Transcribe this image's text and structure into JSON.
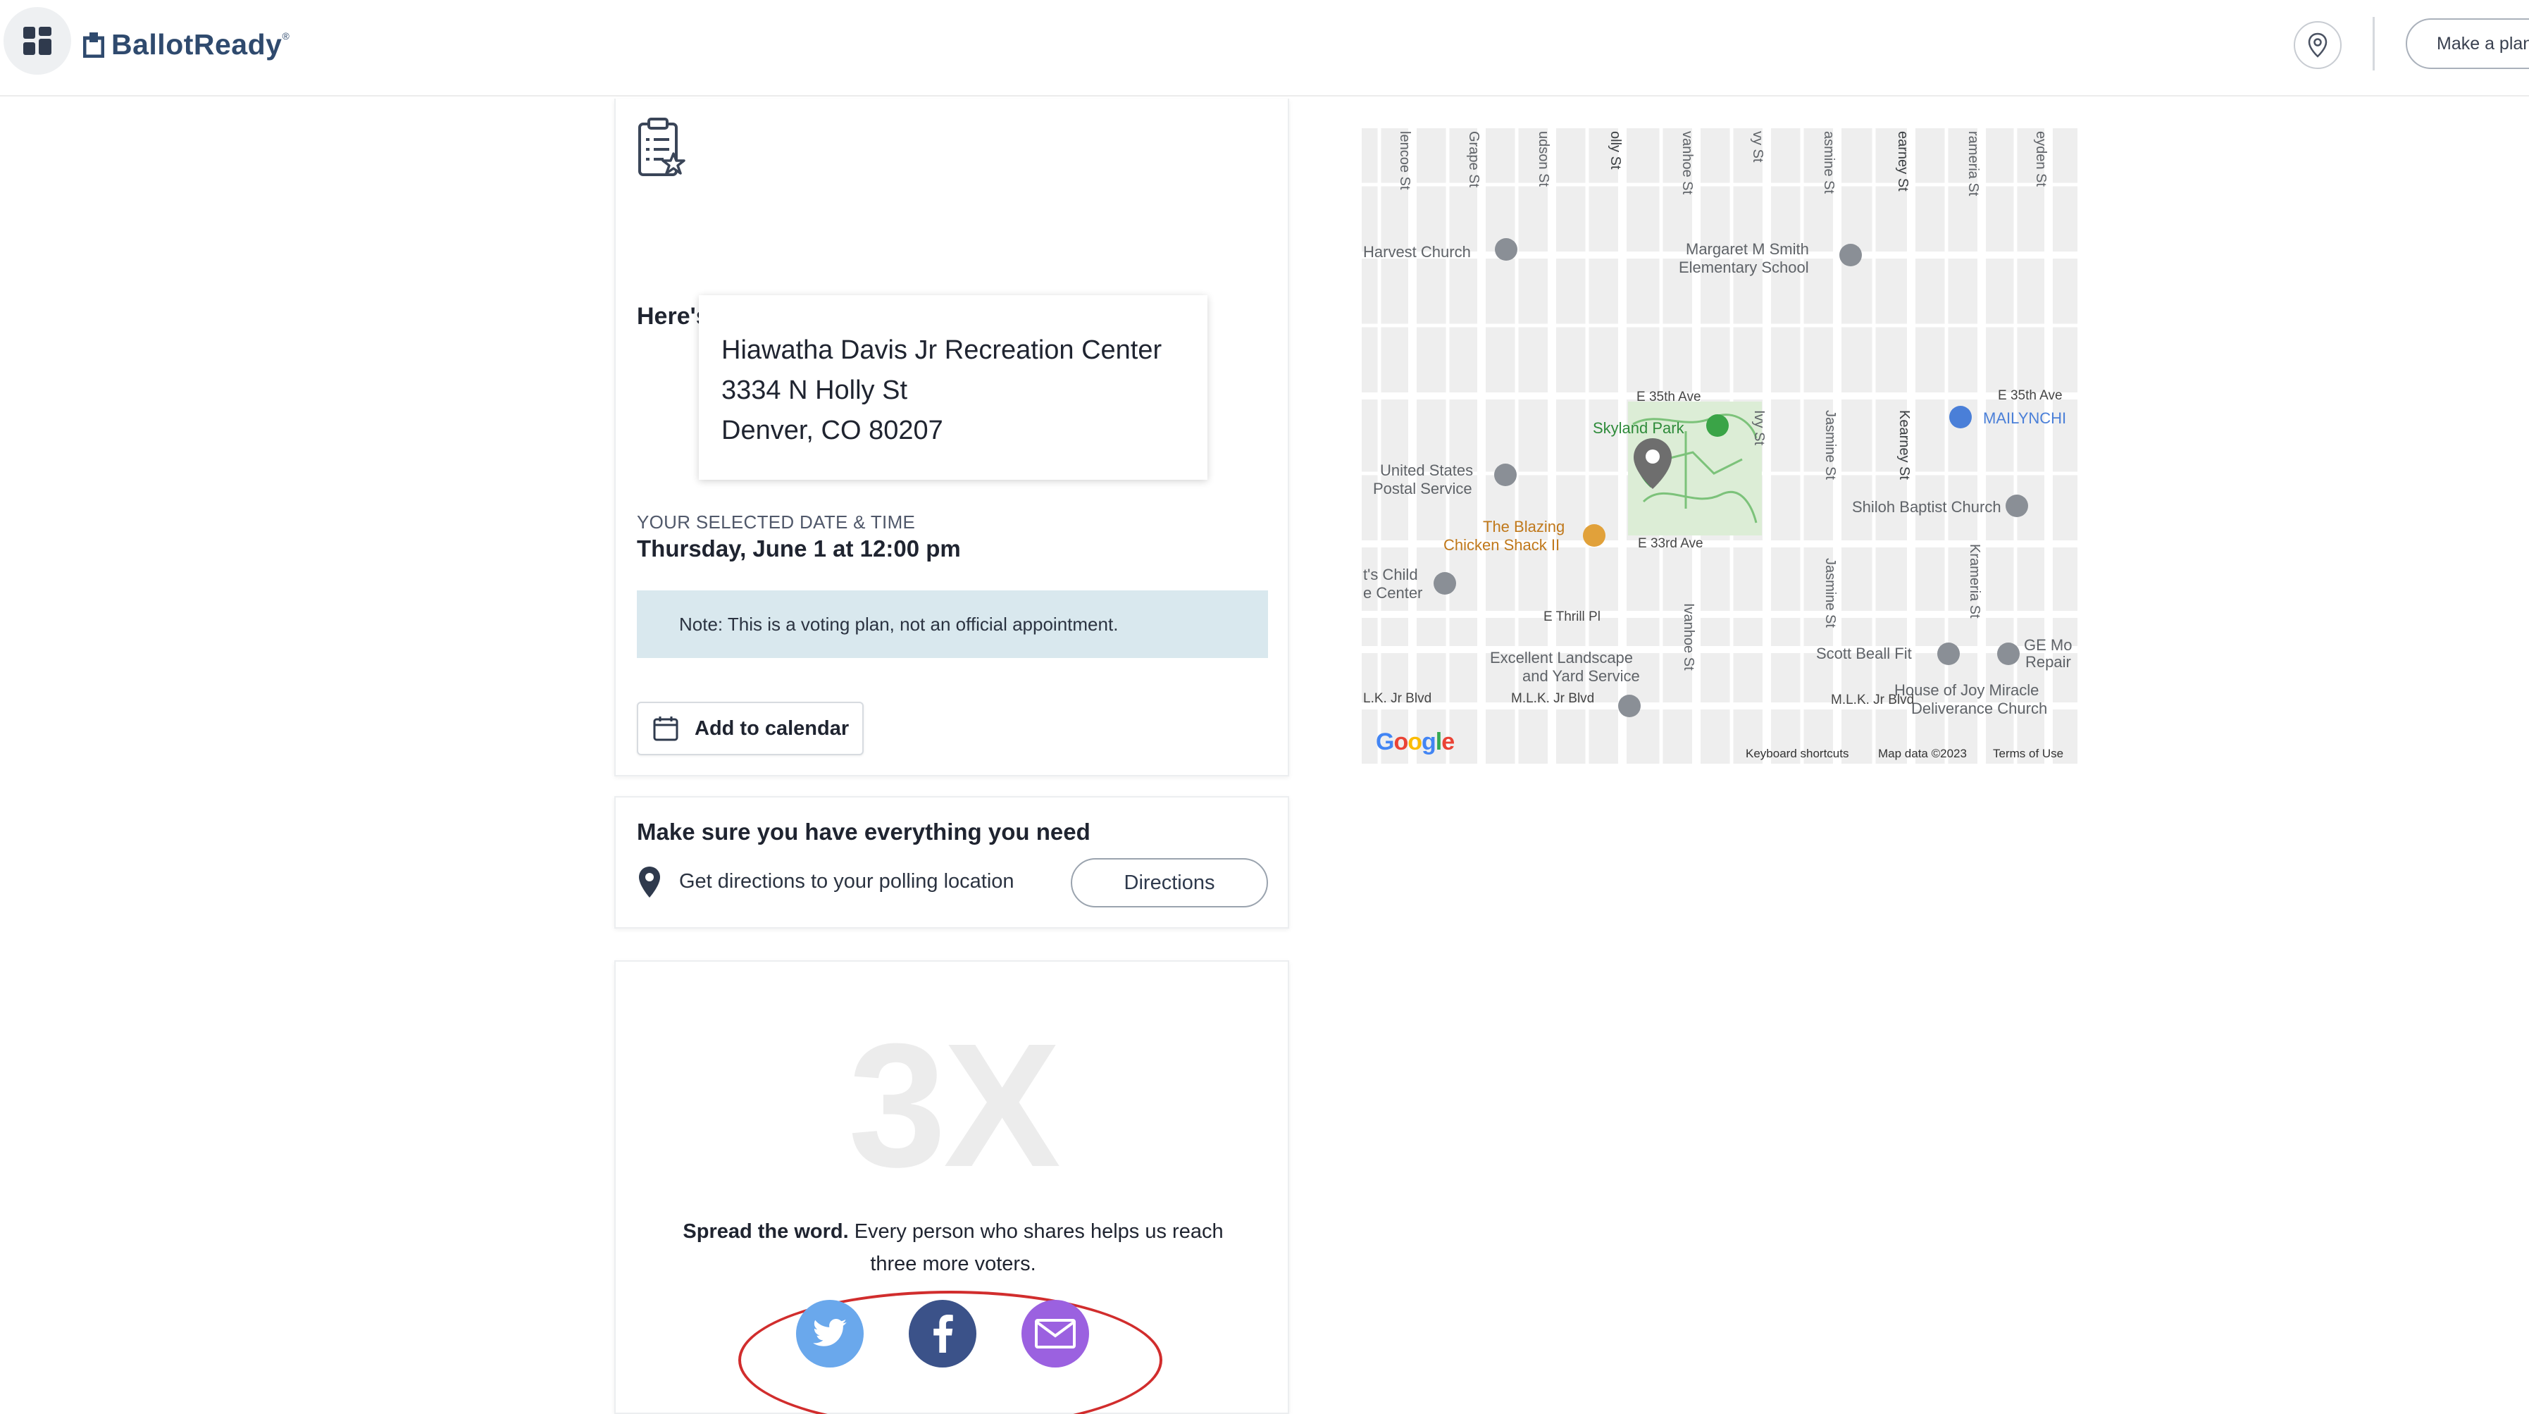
{
  "header": {
    "brand": "BallotReady",
    "brand_reg": "®",
    "make_plan_label": "Make a plan",
    "icons": {
      "menu": "dashboard-grid-icon",
      "location": "location-pin-icon"
    }
  },
  "plan_card": {
    "icon": "clipboard-checklist-icon",
    "summary_title": "Here's your plan summary:",
    "address": {
      "name": "Hiawatha Davis Jr Recreation Center",
      "street": "3334 N Holly St",
      "city": "Denver, CO 80207"
    },
    "selected_label": "YOUR SELECTED DATE & TIME",
    "selected_value": "Thursday, June 1 at 12:00 pm",
    "note": "Note: This is a voting plan, not an official appointment.",
    "add_calendar_label": "Add to calendar"
  },
  "need_card": {
    "title": "Make sure you have everything you need",
    "directions_text": "Get directions to your polling location",
    "directions_button": "Directions"
  },
  "spread_card": {
    "multiplier": "3X",
    "lead": "Spread the word.",
    "text": " Every person who shares helps us reach three more voters.",
    "social": [
      {
        "name": "twitter",
        "icon": "twitter-bird-icon",
        "color": "#6aa8ec"
      },
      {
        "name": "facebook",
        "icon": "facebook-f-icon",
        "color": "#3b5289"
      },
      {
        "name": "email",
        "icon": "envelope-icon",
        "color": "#9b61e0"
      }
    ]
  },
  "map": {
    "street_labels_top": [
      "lencoe St",
      "Grape St",
      "udson St",
      "olly St",
      "vanhoe St",
      "vy St",
      "asmine St",
      "earney St",
      "rameria St",
      "eyden St"
    ],
    "places": {
      "harvest_church": "Harvest Church",
      "margaret_smith_1": "Margaret M Smith",
      "margaret_smith_2": "Elementary School",
      "e35_left": "E 35th Ave",
      "e35_right": "E 35th Ave",
      "skyland_park": "Skyland Park",
      "mailynchi": "MAILYNCHI",
      "usps_1": "United States",
      "usps_2": "Postal Service",
      "shiloh": "Shiloh Baptist Church",
      "blazing_1": "The Blazing",
      "blazing_2": "Chicken Shack II",
      "e33": "E 33rd Ave",
      "child_1": "t's Child",
      "child_2": "e Center",
      "thrill": "E Thrill Pl",
      "scott_beall": "Scott Beall Fit",
      "ge_1": "GE Mo",
      "ge_2": "Repair",
      "excellent_1": "Excellent Landscape",
      "excellent_2": "and Yard Service",
      "house_joy_1": "House of Joy Miracle",
      "house_joy_2": "Deliverance Church",
      "mlk_1": "L.K. Jr Blvd",
      "mlk_2": "M.L.K. Jr Blvd",
      "mlk_3": "M.L.K. Jr Blvd",
      "ivy_v": "Ivy St",
      "jasmine_v": "Jasmine St",
      "kearney_v": "Kearney St",
      "ivanhoe_v": "Ivanhoe St",
      "krameria_v": "Krameria St",
      "jasmine_v2": "Jasmine St"
    },
    "google": "Google",
    "footer": {
      "shortcuts": "Keyboard shortcuts",
      "data": "Map data ©2023",
      "terms": "Terms of Use"
    }
  }
}
